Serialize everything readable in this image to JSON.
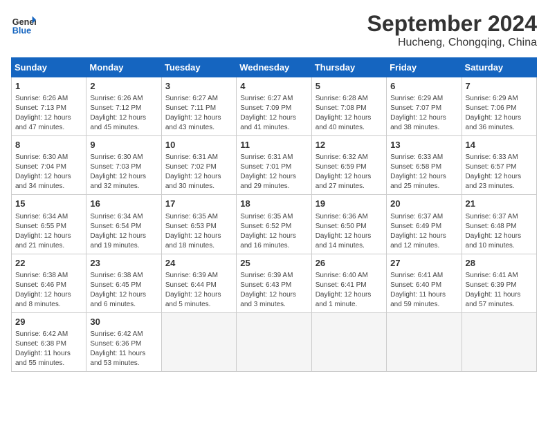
{
  "header": {
    "logo_line1": "General",
    "logo_line2": "Blue",
    "month": "September 2024",
    "location": "Hucheng, Chongqing, China"
  },
  "days_of_week": [
    "Sunday",
    "Monday",
    "Tuesday",
    "Wednesday",
    "Thursday",
    "Friday",
    "Saturday"
  ],
  "weeks": [
    [
      {
        "day": "1",
        "info": "Sunrise: 6:26 AM\nSunset: 7:13 PM\nDaylight: 12 hours\nand 47 minutes."
      },
      {
        "day": "2",
        "info": "Sunrise: 6:26 AM\nSunset: 7:12 PM\nDaylight: 12 hours\nand 45 minutes."
      },
      {
        "day": "3",
        "info": "Sunrise: 6:27 AM\nSunset: 7:11 PM\nDaylight: 12 hours\nand 43 minutes."
      },
      {
        "day": "4",
        "info": "Sunrise: 6:27 AM\nSunset: 7:09 PM\nDaylight: 12 hours\nand 41 minutes."
      },
      {
        "day": "5",
        "info": "Sunrise: 6:28 AM\nSunset: 7:08 PM\nDaylight: 12 hours\nand 40 minutes."
      },
      {
        "day": "6",
        "info": "Sunrise: 6:29 AM\nSunset: 7:07 PM\nDaylight: 12 hours\nand 38 minutes."
      },
      {
        "day": "7",
        "info": "Sunrise: 6:29 AM\nSunset: 7:06 PM\nDaylight: 12 hours\nand 36 minutes."
      }
    ],
    [
      {
        "day": "8",
        "info": "Sunrise: 6:30 AM\nSunset: 7:04 PM\nDaylight: 12 hours\nand 34 minutes."
      },
      {
        "day": "9",
        "info": "Sunrise: 6:30 AM\nSunset: 7:03 PM\nDaylight: 12 hours\nand 32 minutes."
      },
      {
        "day": "10",
        "info": "Sunrise: 6:31 AM\nSunset: 7:02 PM\nDaylight: 12 hours\nand 30 minutes."
      },
      {
        "day": "11",
        "info": "Sunrise: 6:31 AM\nSunset: 7:01 PM\nDaylight: 12 hours\nand 29 minutes."
      },
      {
        "day": "12",
        "info": "Sunrise: 6:32 AM\nSunset: 6:59 PM\nDaylight: 12 hours\nand 27 minutes."
      },
      {
        "day": "13",
        "info": "Sunrise: 6:33 AM\nSunset: 6:58 PM\nDaylight: 12 hours\nand 25 minutes."
      },
      {
        "day": "14",
        "info": "Sunrise: 6:33 AM\nSunset: 6:57 PM\nDaylight: 12 hours\nand 23 minutes."
      }
    ],
    [
      {
        "day": "15",
        "info": "Sunrise: 6:34 AM\nSunset: 6:55 PM\nDaylight: 12 hours\nand 21 minutes."
      },
      {
        "day": "16",
        "info": "Sunrise: 6:34 AM\nSunset: 6:54 PM\nDaylight: 12 hours\nand 19 minutes."
      },
      {
        "day": "17",
        "info": "Sunrise: 6:35 AM\nSunset: 6:53 PM\nDaylight: 12 hours\nand 18 minutes."
      },
      {
        "day": "18",
        "info": "Sunrise: 6:35 AM\nSunset: 6:52 PM\nDaylight: 12 hours\nand 16 minutes."
      },
      {
        "day": "19",
        "info": "Sunrise: 6:36 AM\nSunset: 6:50 PM\nDaylight: 12 hours\nand 14 minutes."
      },
      {
        "day": "20",
        "info": "Sunrise: 6:37 AM\nSunset: 6:49 PM\nDaylight: 12 hours\nand 12 minutes."
      },
      {
        "day": "21",
        "info": "Sunrise: 6:37 AM\nSunset: 6:48 PM\nDaylight: 12 hours\nand 10 minutes."
      }
    ],
    [
      {
        "day": "22",
        "info": "Sunrise: 6:38 AM\nSunset: 6:46 PM\nDaylight: 12 hours\nand 8 minutes."
      },
      {
        "day": "23",
        "info": "Sunrise: 6:38 AM\nSunset: 6:45 PM\nDaylight: 12 hours\nand 6 minutes."
      },
      {
        "day": "24",
        "info": "Sunrise: 6:39 AM\nSunset: 6:44 PM\nDaylight: 12 hours\nand 5 minutes."
      },
      {
        "day": "25",
        "info": "Sunrise: 6:39 AM\nSunset: 6:43 PM\nDaylight: 12 hours\nand 3 minutes."
      },
      {
        "day": "26",
        "info": "Sunrise: 6:40 AM\nSunset: 6:41 PM\nDaylight: 12 hours\nand 1 minute."
      },
      {
        "day": "27",
        "info": "Sunrise: 6:41 AM\nSunset: 6:40 PM\nDaylight: 11 hours\nand 59 minutes."
      },
      {
        "day": "28",
        "info": "Sunrise: 6:41 AM\nSunset: 6:39 PM\nDaylight: 11 hours\nand 57 minutes."
      }
    ],
    [
      {
        "day": "29",
        "info": "Sunrise: 6:42 AM\nSunset: 6:38 PM\nDaylight: 11 hours\nand 55 minutes."
      },
      {
        "day": "30",
        "info": "Sunrise: 6:42 AM\nSunset: 6:36 PM\nDaylight: 11 hours\nand 53 minutes."
      },
      {
        "day": "",
        "info": ""
      },
      {
        "day": "",
        "info": ""
      },
      {
        "day": "",
        "info": ""
      },
      {
        "day": "",
        "info": ""
      },
      {
        "day": "",
        "info": ""
      }
    ]
  ]
}
